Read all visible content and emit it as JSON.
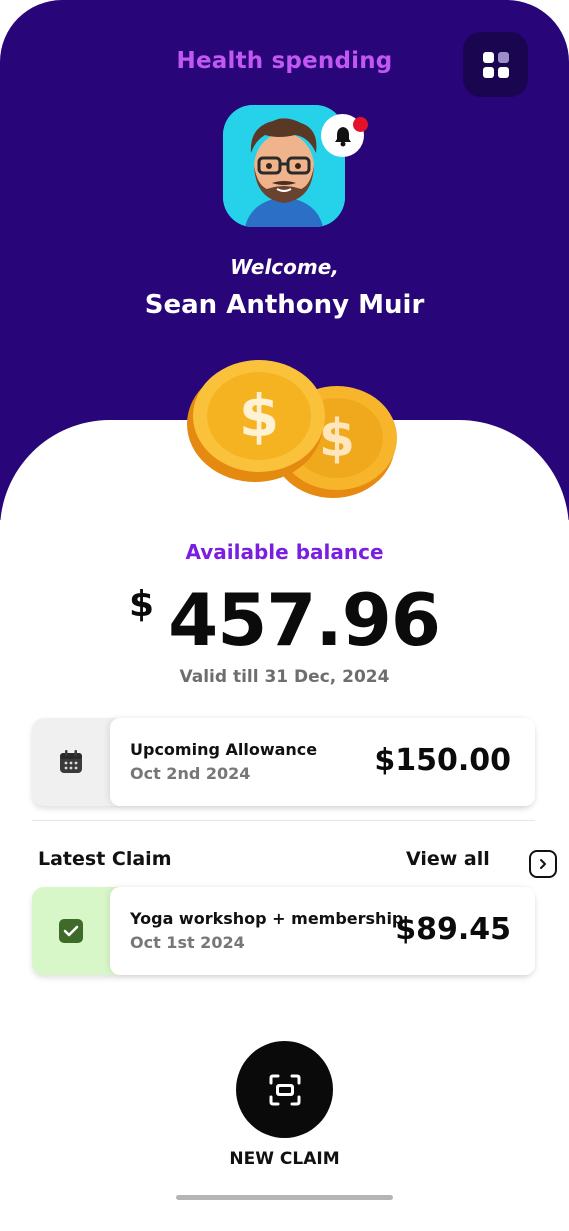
{
  "header": {
    "title": "Health spending"
  },
  "user": {
    "welcome": "Welcome,",
    "name": "Sean Anthony Muir"
  },
  "balance": {
    "label": "Available balance",
    "currency": "$",
    "amount": "457.96",
    "valid": "Valid till 31 Dec, 2024"
  },
  "allowance": {
    "title": "Upcoming Allowance",
    "date": "Oct 2nd 2024",
    "amount": "$150.00"
  },
  "claims": {
    "heading": "Latest Claim",
    "view_all": "View all",
    "latest": {
      "title": "Yoga workshop + membership",
      "date": "Oct 1st 2024",
      "amount": "$89.45"
    }
  },
  "actions": {
    "new_claim": "NEW CLAIM"
  },
  "colors": {
    "header_bg": "#29057a",
    "accent": "#7a1fe0",
    "title": "#c257f2",
    "notify": "#e4112a",
    "claim_bg": "#d8f7c9"
  },
  "icons": [
    "grid-icon",
    "bell-icon",
    "calendar-icon",
    "check-icon",
    "chevron-right-icon",
    "scan-icon"
  ]
}
